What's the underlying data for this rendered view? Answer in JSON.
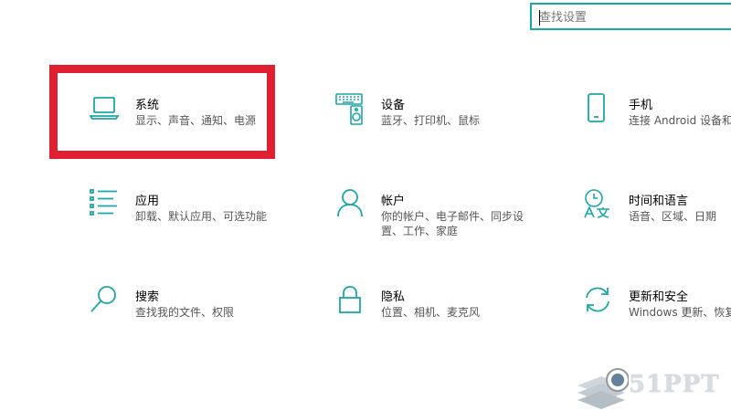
{
  "search": {
    "placeholder": "查找设置",
    "value": ""
  },
  "colors": {
    "accent": "#1aa7a7",
    "highlight": "#e02030",
    "title": "#000000",
    "description": "#555555"
  },
  "tiles": [
    {
      "icon": "laptop-icon",
      "title": "系统",
      "desc1": "显示、声音、通知、电源",
      "desc2": ""
    },
    {
      "icon": "keyboard-speaker-icon",
      "title": "设备",
      "desc1": "蓝牙、打印机、鼠标",
      "desc2": ""
    },
    {
      "icon": "phone-icon",
      "title": "手机",
      "desc1": "连接 Android 设备和",
      "desc2": ""
    },
    {
      "icon": "apps-list-icon",
      "title": "应用",
      "desc1": "卸载、默认应用、可选功能",
      "desc2": ""
    },
    {
      "icon": "person-icon",
      "title": "帐户",
      "desc1": "你的帐户、电子邮件、同步设",
      "desc2": "置、工作、家庭"
    },
    {
      "icon": "time-language-icon",
      "title": "时间和语言",
      "desc1": "语音、区域、日期",
      "desc2": ""
    },
    {
      "icon": "search-icon",
      "title": "搜索",
      "desc1": "查找我的文件、权限",
      "desc2": ""
    },
    {
      "icon": "lock-icon",
      "title": "隐私",
      "desc1": "位置、相机、麦克风",
      "desc2": ""
    },
    {
      "icon": "sync-icon",
      "title": "更新和安全",
      "desc1": "Windows 更新、恢复",
      "desc2": ""
    }
  ],
  "watermark": {
    "text": "51PPT",
    "icon": "logo-icon"
  }
}
